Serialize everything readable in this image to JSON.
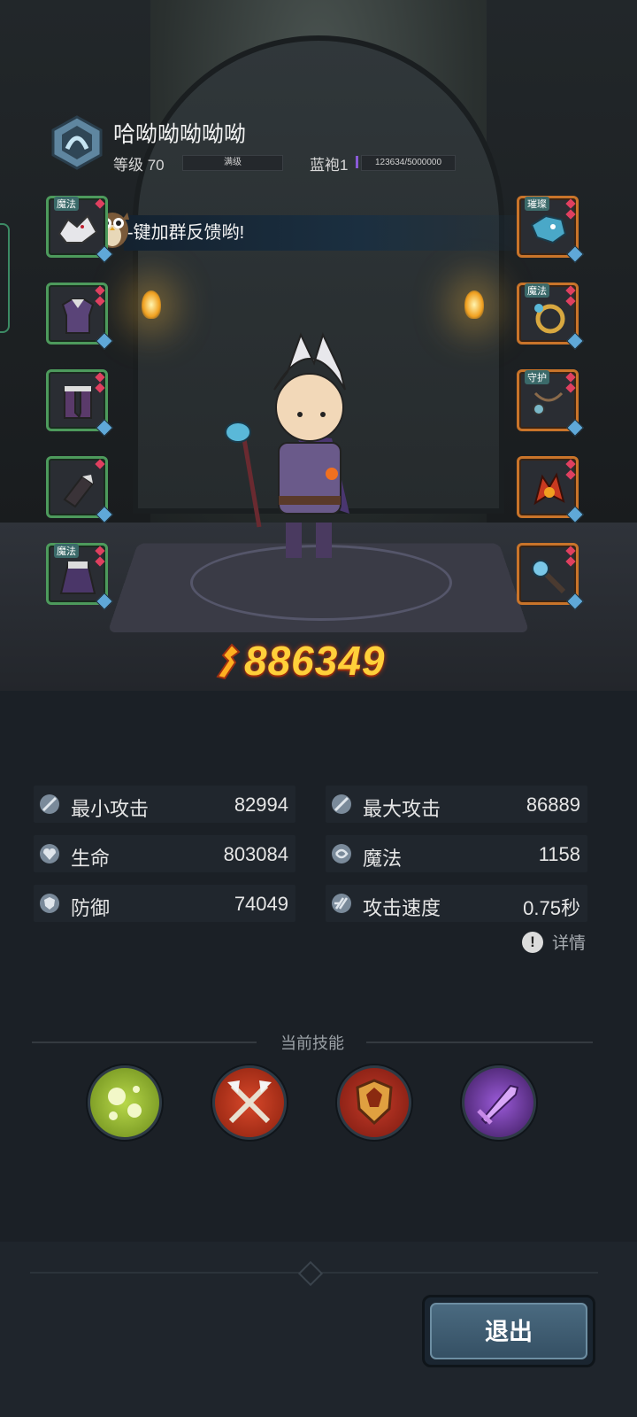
{
  "player": {
    "name": "哈呦呦呦呦呦",
    "level_label": "等级 70",
    "level_bar_text": "满级",
    "rank_label": "蓝袍1",
    "exp_text": "123634/5000000"
  },
  "banner": {
    "text": "-键加群反馈哟!"
  },
  "equipment": {
    "left": [
      {
        "tag": "魔法",
        "icon": "white-wolf-pet-icon"
      },
      {
        "tag": "",
        "icon": "purple-armor-icon"
      },
      {
        "tag": "",
        "icon": "purple-boots-icon"
      },
      {
        "tag": "",
        "icon": "bracer-icon"
      },
      {
        "tag": "魔法",
        "icon": "purple-cloak-icon"
      }
    ],
    "right": [
      {
        "tag": "璀璨",
        "icon": "ice-dragon-helmet-icon"
      },
      {
        "tag": "魔法",
        "icon": "gold-ring-icon"
      },
      {
        "tag": "守护",
        "icon": "amulet-icon"
      },
      {
        "tag": "",
        "icon": "fire-emblem-icon"
      },
      {
        "tag": "",
        "icon": "blue-mace-icon"
      }
    ]
  },
  "combat_power": "886349",
  "stats": {
    "min_attack": {
      "label": "最小攻击",
      "value": "82994"
    },
    "max_attack": {
      "label": "最大攻击",
      "value": "86889"
    },
    "hp": {
      "label": "生命",
      "value": "803084"
    },
    "magic": {
      "label": "魔法",
      "value": "1158"
    },
    "defense": {
      "label": "防御",
      "value": "74049"
    },
    "attack_speed": {
      "label": "攻击速度",
      "value": "0.75秒"
    }
  },
  "details_label": "详情",
  "skills": {
    "title": "当前技能",
    "items": [
      {
        "icon": "green-bubbles-skill-icon",
        "color": "#9ac23a"
      },
      {
        "icon": "crossed-axes-skill-icon",
        "color": "#b8321e"
      },
      {
        "icon": "shield-crest-skill-icon",
        "color": "#a22e1e"
      },
      {
        "icon": "purple-sword-skill-icon",
        "color": "#7a3ab8"
      }
    ]
  },
  "exit_label": "退出",
  "colors": {
    "background": "#1b2026",
    "power_gold": "#ffd03a",
    "green_frame": "#4d9a5c",
    "orange_frame": "#c9742a"
  }
}
